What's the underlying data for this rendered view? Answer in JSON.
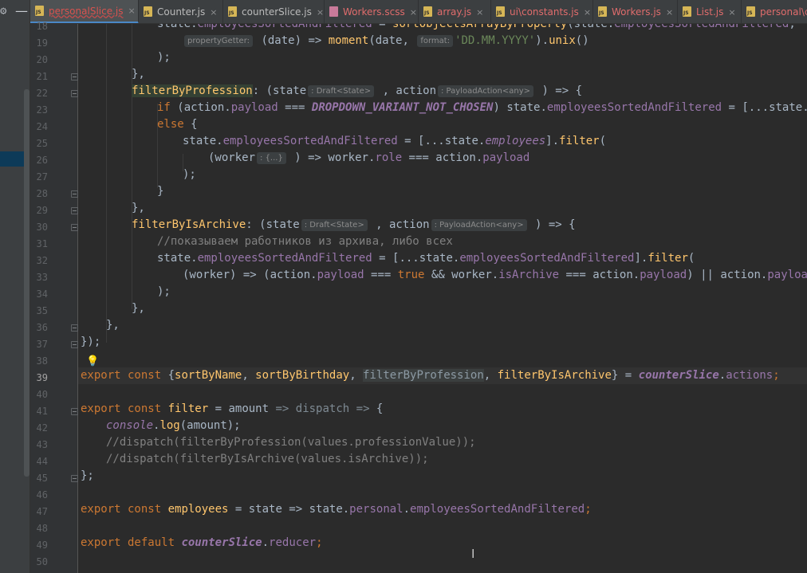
{
  "left_strip": {
    "gear_icon": "gear-icon",
    "minimize_glyph": "—"
  },
  "tabs": [
    {
      "label": "personalSlice.js",
      "icon": "js-file-icon",
      "kind": "js",
      "active": true,
      "state": "error",
      "close": "×"
    },
    {
      "label": "Counter.js",
      "icon": "js-file-icon",
      "kind": "js",
      "state": "normal",
      "close": "×"
    },
    {
      "label": "counterSlice.js",
      "icon": "js-file-icon",
      "kind": "js",
      "state": "normal",
      "close": "×"
    },
    {
      "label": "Workers.scss",
      "icon": "scss-file-icon",
      "kind": "scss",
      "state": "error",
      "close": "×"
    },
    {
      "label": "array.js",
      "icon": "js-file-icon",
      "kind": "js",
      "state": "error",
      "close": "×"
    },
    {
      "label": "ui\\constants.js",
      "icon": "js-file-icon",
      "kind": "js",
      "state": "error",
      "close": "×"
    },
    {
      "label": "Workers.js",
      "icon": "js-file-icon",
      "kind": "js",
      "state": "error",
      "close": "×"
    },
    {
      "label": "List.js",
      "icon": "js-file-icon",
      "kind": "js",
      "state": "error",
      "close": "×"
    },
    {
      "label": "personal\\c",
      "icon": "js-file-icon",
      "kind": "js",
      "state": "error",
      "close": ""
    }
  ],
  "file_icon_text": "JS",
  "gutter": {
    "line_numbers": [
      "18",
      "19",
      "20",
      "21",
      "22",
      "23",
      "24",
      "25",
      "26",
      "27",
      "28",
      "29",
      "30",
      "31",
      "32",
      "33",
      "34",
      "35",
      "36",
      "37",
      "38",
      "39",
      "40",
      "41",
      "42",
      "43",
      "44",
      "45",
      "46",
      "47",
      "48",
      "49",
      "50"
    ],
    "current_line": "39",
    "intention_icon": "lightbulb-icon"
  },
  "code": {
    "l18": [
      "state.",
      "employeesSortedAndFiltered",
      " = ",
      "sortObjectsArrayByProperty",
      "(state.",
      "employeesSortedAndFiltered",
      ",  ",
      "propertyGetter"
    ],
    "l19": [
      "propertyGetter:",
      " (date) => ",
      "moment",
      "(date, ",
      "format:",
      "'DD.MM.YYYY'",
      ").",
      "unix",
      "()"
    ],
    "l20": [
      ");"
    ],
    "l21": [
      "},"
    ],
    "l22": [
      "filterByProfession",
      ": (state",
      ": Draft<State>",
      " , action",
      ": PayloadAction<any>",
      " ) => {"
    ],
    "l23": [
      "if",
      " (action.",
      "payload",
      " === ",
      "DROPDOWN_VARIANT_NOT_CHOSEN",
      ") state.",
      "employeesSortedAndFiltered",
      " = [...state.",
      "emplo"
    ],
    "l24": [
      "else",
      " {"
    ],
    "l25": [
      "state.",
      "employeesSortedAndFiltered",
      " = [...state.",
      "employees",
      "].",
      "filter",
      "("
    ],
    "l26": [
      "(worker",
      ": {...}",
      " ) => worker.",
      "role",
      " === action.",
      "payload"
    ],
    "l27": [
      ");"
    ],
    "l28": [
      "}"
    ],
    "l29": [
      "},"
    ],
    "l30": [
      "filterByIsArchive",
      ": (state",
      ": Draft<State>",
      " , action",
      ": PayloadAction<any>",
      " ) => {"
    ],
    "l31": [
      "//показываем работников из архива, либо всех"
    ],
    "l32": [
      "state.",
      "employeesSortedAndFiltered",
      " = [...state.",
      "employeesSortedAndFiltered",
      "].",
      "filter",
      "("
    ],
    "l33": [
      "(worker) => (action.",
      "payload",
      " === ",
      "true",
      " && worker.",
      "isArchive",
      " === action.",
      "payload",
      ") || action.",
      "payload",
      " ==="
    ],
    "l34": [
      ");"
    ],
    "l35": [
      "},"
    ],
    "l36": [
      "},"
    ],
    "l37": [
      "});"
    ],
    "l39": [
      "export const",
      " {",
      "sortByName",
      ", ",
      "sortByBirthday",
      ", ",
      "filterByProfession",
      ", ",
      "filterByIsArchive",
      "} = ",
      "counterSlice",
      ".",
      "actions",
      ";"
    ],
    "l41": [
      "export const",
      " ",
      "filter",
      " = amount ",
      "=>",
      " ",
      "dispatch",
      " ",
      "=>",
      " {"
    ],
    "l42": [
      "console",
      ".",
      "log",
      "(amount);"
    ],
    "l43": [
      "//dispatch(filterByProfession(values.professionValue));"
    ],
    "l44": [
      "//dispatch(filterByIsArchive(values.isArchive));"
    ],
    "l45": [
      "};"
    ],
    "l47": [
      "export const",
      " ",
      "employees",
      " = state => state.",
      "personal",
      ".",
      "employeesSortedAndFiltered",
      ";"
    ],
    "l49": [
      "export default",
      " ",
      "counterSlice",
      ".",
      "reducer",
      ";"
    ]
  },
  "cursor_icon": "text-cursor-icon"
}
